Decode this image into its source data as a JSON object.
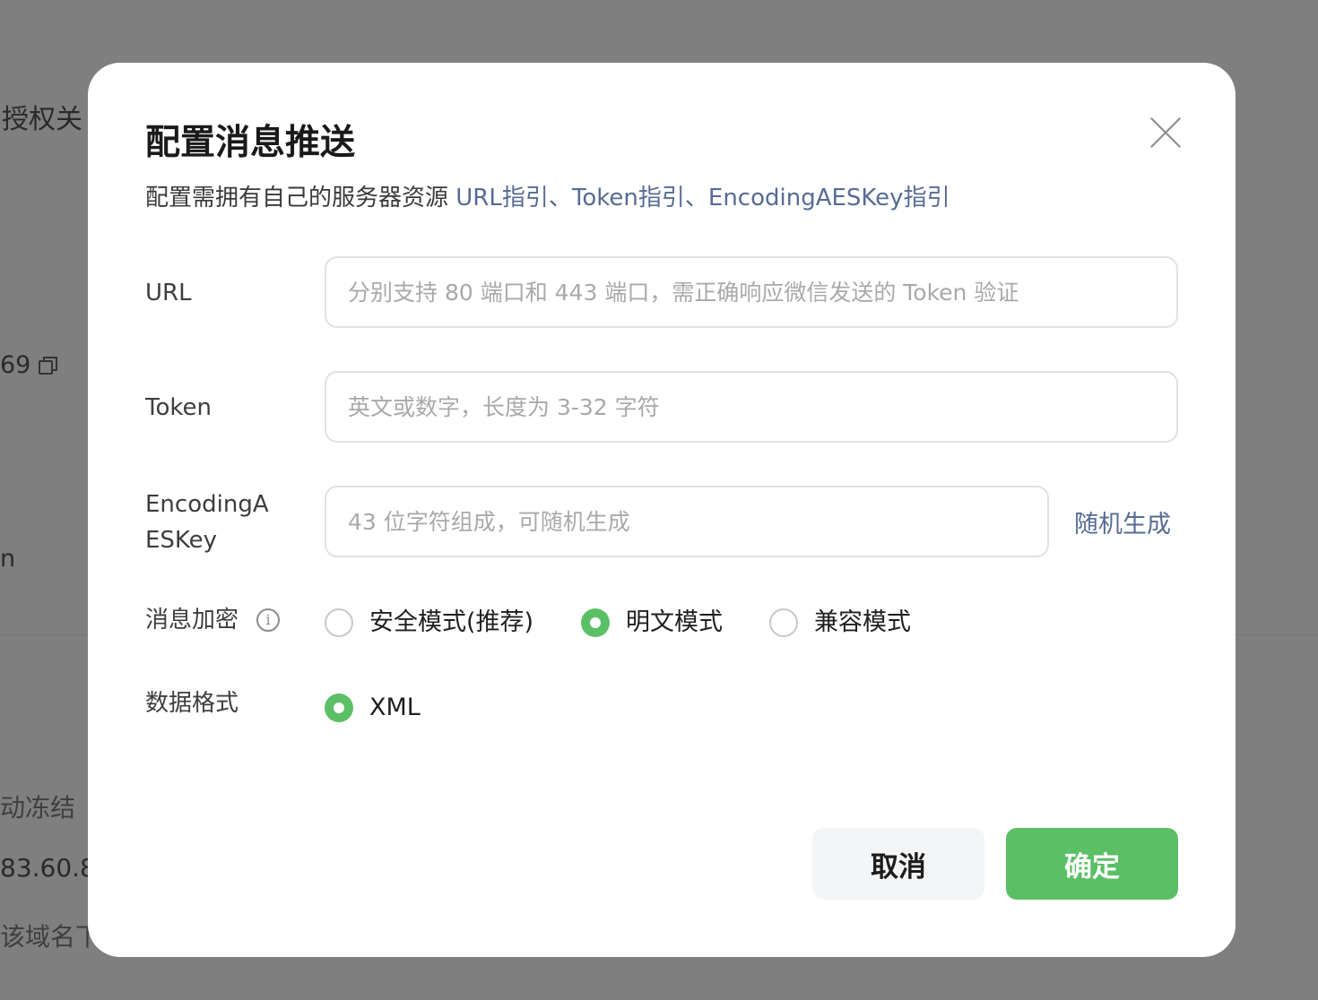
{
  "background": {
    "fragments": [
      "授权关",
      "69",
      "n",
      "动冻结",
      "83.60.8",
      "该域名下"
    ]
  },
  "modal": {
    "title": "配置消息推送",
    "description": {
      "text": "配置需拥有自己的服务器资源",
      "links": [
        "URL指引",
        "、",
        "Token指引",
        "、",
        "EncodingAESKey指引"
      ]
    },
    "fields": {
      "url": {
        "label": "URL",
        "placeholder": "分别支持 80 端口和 443 端口，需正确响应微信发送的 Token 验证",
        "value": ""
      },
      "token": {
        "label": "Token",
        "placeholder": "英文或数字，长度为 3-32 字符",
        "value": ""
      },
      "aes": {
        "label_line1": "EncodingA",
        "label_line2": "ESKey",
        "placeholder": "43 位字符组成，可随机生成",
        "value": "",
        "random_label": "随机生成"
      }
    },
    "encryption": {
      "label": "消息加密",
      "options": [
        {
          "label": "安全模式(推荐)",
          "checked": false
        },
        {
          "label": "明文模式",
          "checked": true
        },
        {
          "label": "兼容模式",
          "checked": false
        }
      ]
    },
    "data_format": {
      "label": "数据格式",
      "options": [
        {
          "label": "XML",
          "checked": true
        }
      ]
    },
    "buttons": {
      "cancel": "取消",
      "confirm": "确定"
    },
    "colors": {
      "accent": "#5bbf66",
      "link": "#576b95"
    }
  }
}
